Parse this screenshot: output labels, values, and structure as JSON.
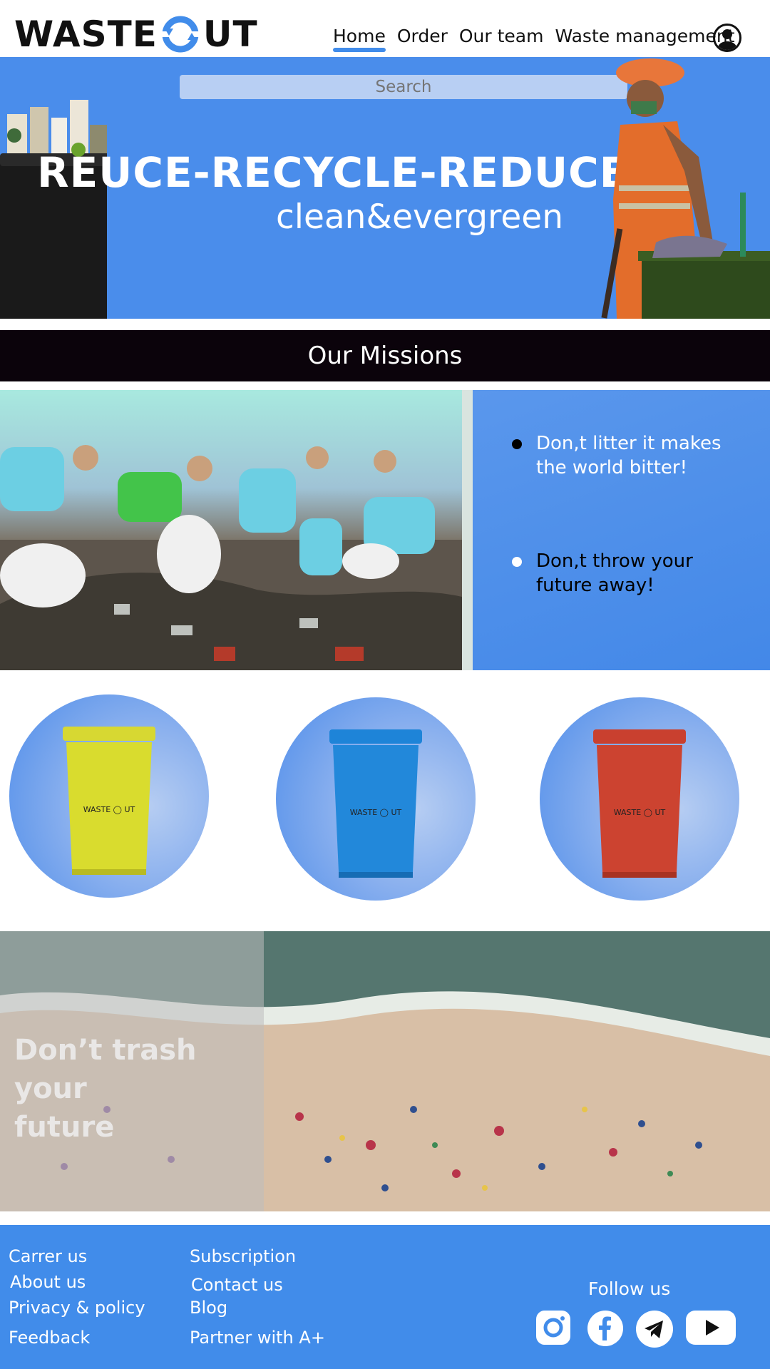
{
  "logo": {
    "text_left": "WASTE",
    "text_right": "UT"
  },
  "nav": {
    "items": [
      {
        "label": "Home",
        "active": true
      },
      {
        "label": "Order",
        "active": false
      },
      {
        "label": "Our team",
        "active": false
      },
      {
        "label": "Waste management",
        "active": false
      }
    ],
    "user_icon": "user-circle-icon"
  },
  "hero": {
    "search_placeholder": "Search",
    "title": "REUCE-RECYCLE-REDUCE",
    "subtitle": "clean&evergreen",
    "background": "#4a8deb"
  },
  "missions": {
    "heading": "Our Missions",
    "items": [
      {
        "text_line1": "Don,t litter it makes",
        "text_line2": "the world bitter!",
        "color": "#ffffff",
        "bullet": "#000000"
      },
      {
        "text_line1": "Don,t throw your",
        "text_line2": "future away!",
        "color": "#000000",
        "bullet": "#ffffff"
      }
    ]
  },
  "bins": [
    {
      "color": "yellow",
      "hex": "#d7d832",
      "label_left": "WASTE",
      "label_right": "UT"
    },
    {
      "color": "blue",
      "hex": "#1e84d8",
      "label_left": "WASTE",
      "label_right": "UT"
    },
    {
      "color": "red",
      "hex": "#c9402f",
      "label_left": "WASTE",
      "label_right": "UT"
    }
  ],
  "banner": {
    "text_line1": "Don’t trash your",
    "text_line2": "future"
  },
  "footer": {
    "col1": [
      "Carrer us",
      "About us",
      "Privacy & policy",
      "Feedback"
    ],
    "col2": [
      "Subscription",
      "Contact us",
      "Blog",
      "Partner with A+"
    ],
    "follow_label": "Follow us",
    "social": [
      "instagram-icon",
      "facebook-icon",
      "telegram-icon",
      "youtube-icon"
    ],
    "background": "#418cea"
  }
}
